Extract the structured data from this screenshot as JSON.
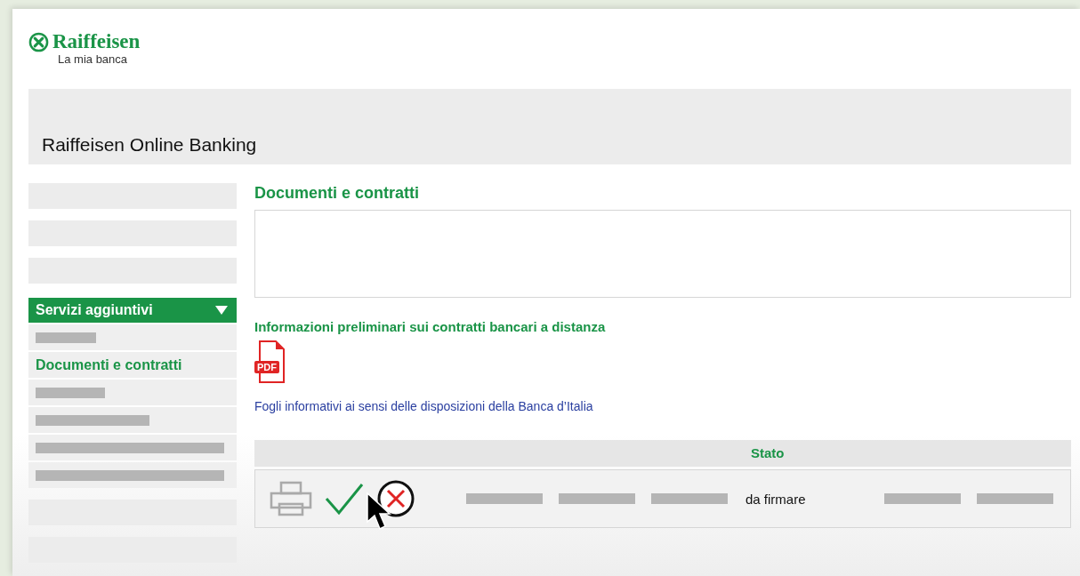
{
  "logo": {
    "name": "Raiffeisen",
    "tagline": "La mia banca"
  },
  "banner": {
    "title": "Raiffeisen Online Banking"
  },
  "sidebar": {
    "items": [
      {
        "kind": "blank"
      },
      {
        "kind": "blank"
      },
      {
        "kind": "blank"
      },
      {
        "kind": "section",
        "label": "Servizi aggiuntivi",
        "expanded": true,
        "children": [
          {
            "kind": "placeholder"
          },
          {
            "kind": "link",
            "label": "Documenti e contratti",
            "selected": true
          },
          {
            "kind": "placeholder"
          },
          {
            "kind": "placeholder"
          },
          {
            "kind": "placeholder"
          },
          {
            "kind": "placeholder"
          }
        ]
      },
      {
        "kind": "blank"
      },
      {
        "kind": "blank"
      }
    ]
  },
  "content": {
    "title": "Documenti e contratti",
    "info_heading": "Informazioni preliminari sui contratti bancari a distanza",
    "pdf_label": "PDF",
    "link": "Fogli informativi ai sensi delle disposizioni della Banca d’Italia",
    "table": {
      "rows": [
        {
          "cells": [
            {
              "kind": "actions"
            },
            {
              "kind": "bar"
            },
            {
              "kind": "bar"
            },
            {
              "kind": "bar"
            },
            {
              "kind": "text",
              "heading": "Stato",
              "value": "da firmare"
            },
            {
              "kind": "bar"
            },
            {
              "kind": "bar"
            }
          ]
        }
      ]
    }
  }
}
